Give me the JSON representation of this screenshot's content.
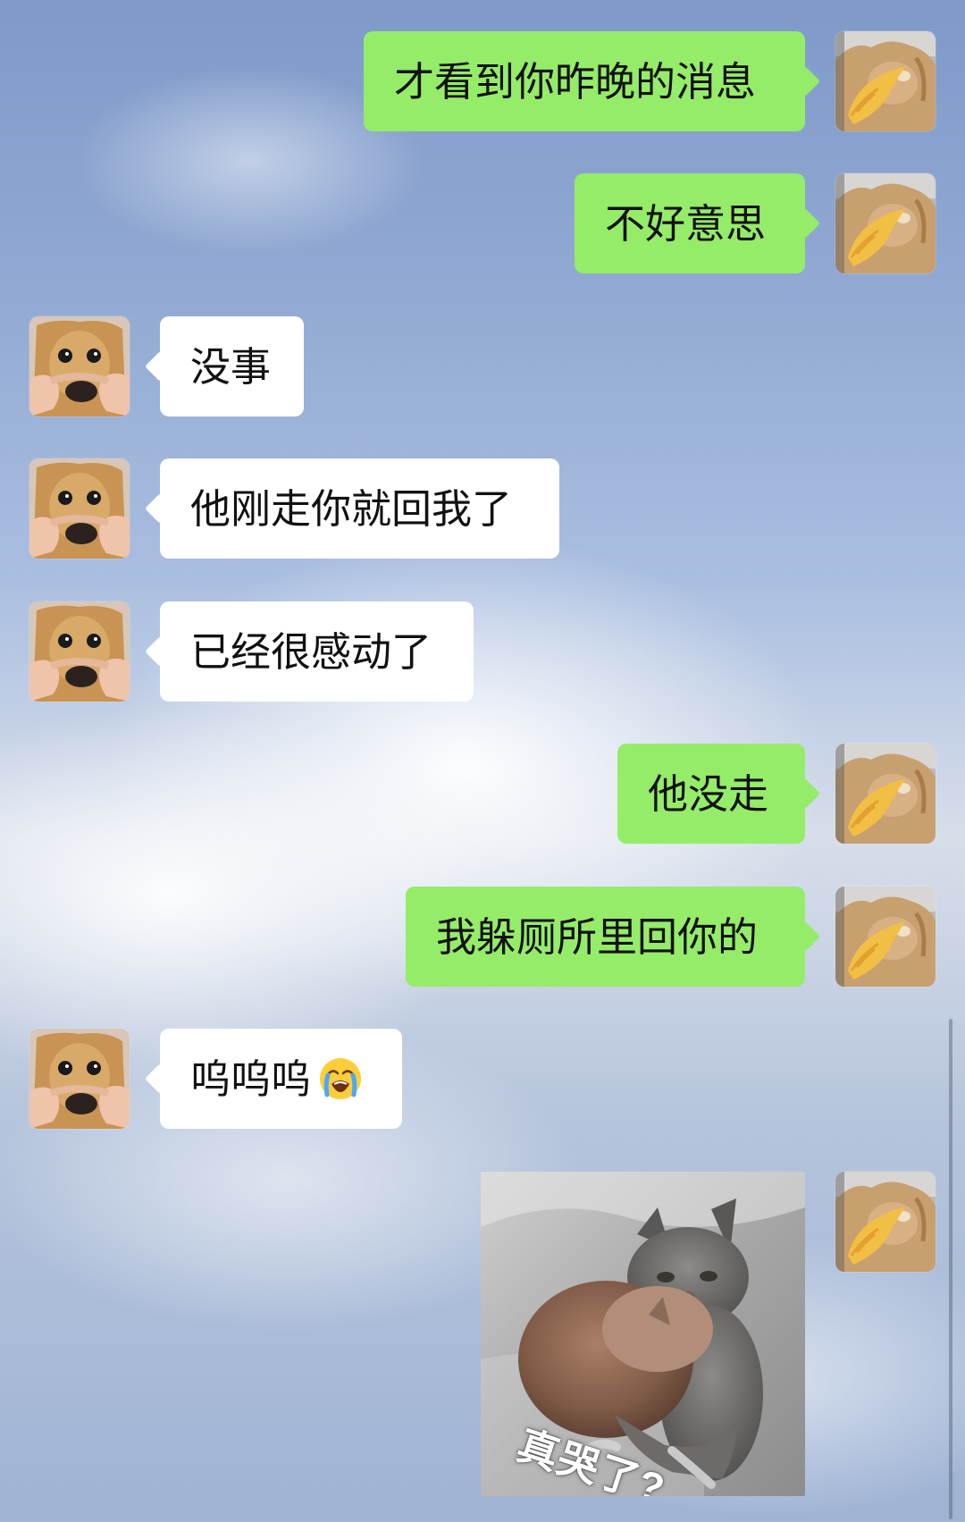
{
  "chat": {
    "messages": [
      {
        "side": "self",
        "text": "才看到你昨晚的消息"
      },
      {
        "side": "self",
        "text": "不好意思"
      },
      {
        "side": "other",
        "text": "没事"
      },
      {
        "side": "other",
        "text": "他刚走你就回我了"
      },
      {
        "side": "other",
        "text": "已经很感动了"
      },
      {
        "side": "self",
        "text": "他没走"
      },
      {
        "side": "self",
        "text": "我躲厕所里回你的"
      },
      {
        "side": "other",
        "text": "呜呜呜"
      },
      {
        "side": "self",
        "type": "sticker",
        "caption": "真哭了?"
      }
    ]
  },
  "colors": {
    "self_bubble": "#95ec69",
    "other_bubble": "#ffffff",
    "background_sky": "#8aa3d0"
  },
  "icons": {
    "self_avatar": "cat-holding-fish-avatar",
    "other_avatar": "dog-face-avatar",
    "emoji": "loudly-crying-face-icon"
  }
}
